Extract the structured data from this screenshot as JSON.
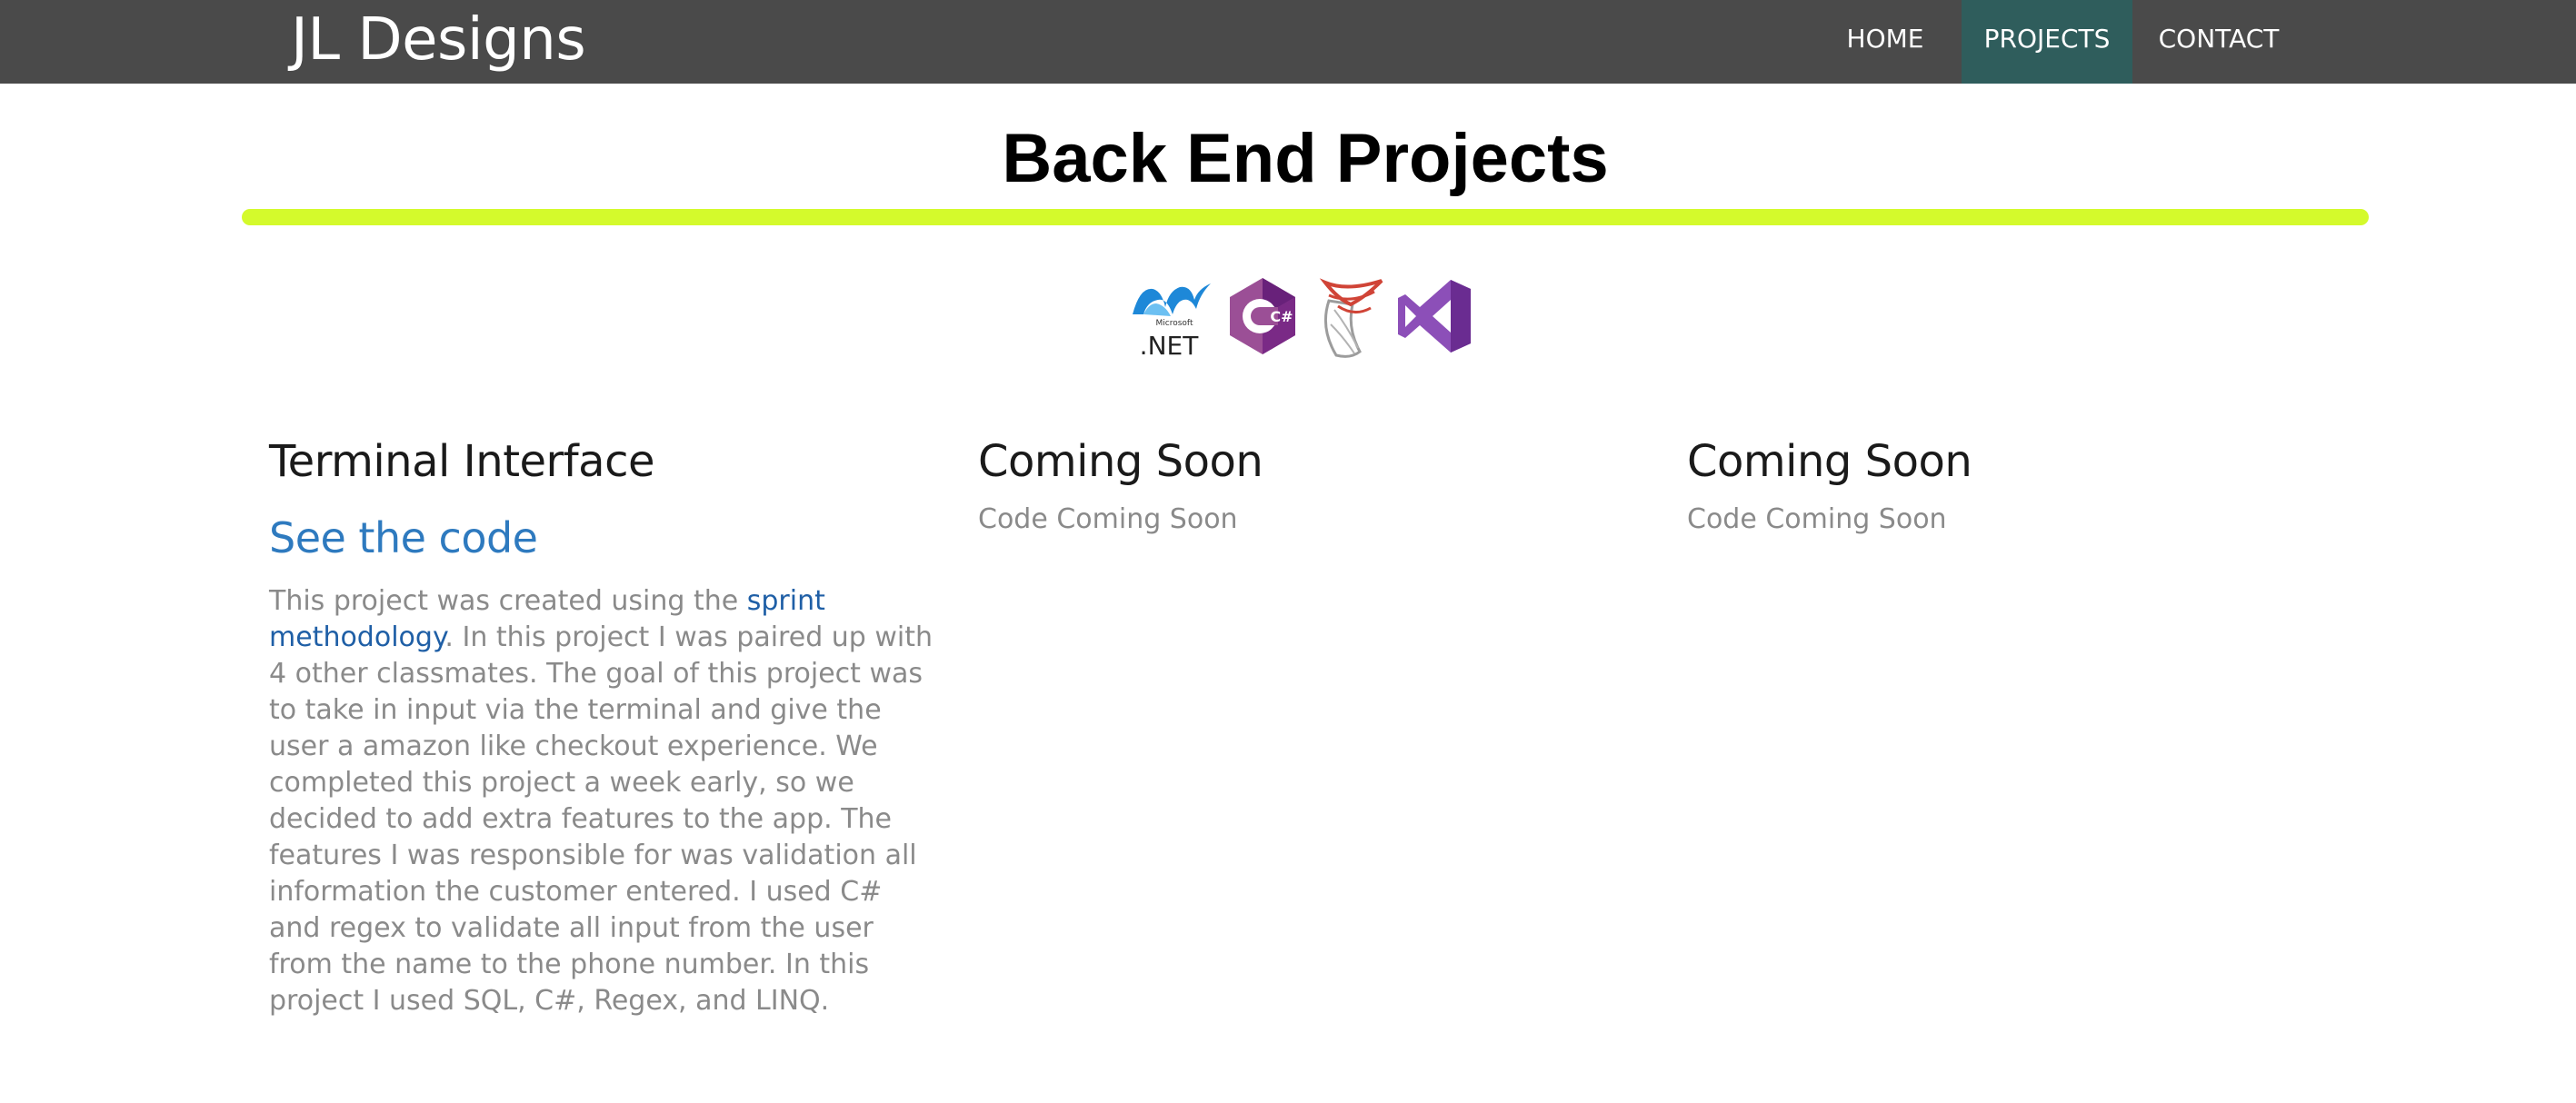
{
  "navbar": {
    "brand": "JL Designs",
    "links": [
      {
        "label": "HOME"
      },
      {
        "label": "PROJECTS",
        "active": true
      },
      {
        "label": "CONTACT"
      }
    ],
    "background_color": "#4a4a4a",
    "active_color": "#2f5d5c"
  },
  "header": {
    "title": "Back End Projects",
    "rule_color": "#d4fa2c"
  },
  "tech_icons": [
    {
      "name": "dotnet-icon",
      "label": ".NET",
      "sublabel": "Microsoft"
    },
    {
      "name": "csharp-icon",
      "label": "C#"
    },
    {
      "name": "sql-server-icon"
    },
    {
      "name": "visual-studio-icon"
    }
  ],
  "projects": [
    {
      "title": "Terminal Interface",
      "link_label": "See the code",
      "desc_before": "This project was created using the ",
      "desc_link": "sprint methodology",
      "desc_after": ". In this project I was paired up with 4 other classmates. The goal of this project was to take in input via the terminal and give the user a amazon like checkout experience. We completed this project a week early, so we decided to add extra features to the app. The features I was responsible for was validation all information the customer entered. I used C# and regex to validate all input from the user from the name to the phone number. In this project I used SQL, C#, Regex, and LINQ."
    },
    {
      "title": "Coming Soon",
      "text": "Code Coming Soon"
    },
    {
      "title": "Coming Soon",
      "text": "Code Coming Soon"
    }
  ],
  "colors": {
    "link": "#2e7abf",
    "body_text": "#8a8a8a"
  }
}
